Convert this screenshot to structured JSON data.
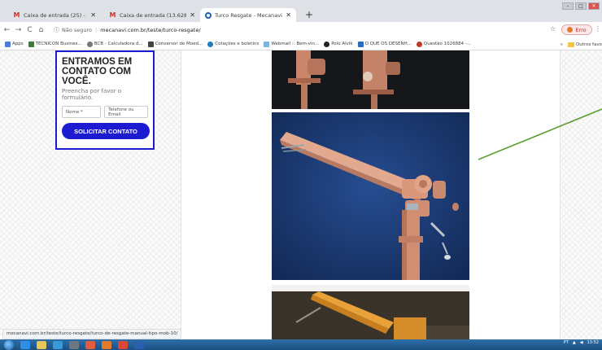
{
  "tabs": [
    {
      "title": "Caixa de entrada (25) - amasson...",
      "icon": "gmail-icon",
      "active": false
    },
    {
      "title": "Caixa de entrada (13.628) - amc...",
      "icon": "gmail-icon",
      "active": false
    },
    {
      "title": "Turco Resgate - Mecanavi",
      "icon": "site-icon",
      "active": true
    }
  ],
  "address": {
    "security": "Não seguro",
    "url": "mecanavi.com.br/teste/turco-resgate/"
  },
  "profile": {
    "label": "Erro"
  },
  "bookmarks": [
    {
      "label": "Apps",
      "color": "#4a7fd4"
    },
    {
      "label": "TECNICON Busines...",
      "color": "#3a7d3a"
    },
    {
      "label": "BCB - Calculadora d...",
      "color": "#777777"
    },
    {
      "label": "Conversor de Moed...",
      "color": "#444444"
    },
    {
      "label": "Cotações e boletins",
      "color": "#1e7fc0"
    },
    {
      "label": "Webmail :: Bem-vin...",
      "color": "#7ab4e0"
    },
    {
      "label": "Polo Alvik",
      "color": "#222222"
    },
    {
      "label": "O QUE OS DESENH...",
      "color": "#2b6bc4"
    },
    {
      "label": "Questão 1026884 -...",
      "color": "#c0392b"
    }
  ],
  "bookmarks_overflow": "»",
  "other_bookmarks": "Outros favo",
  "contact": {
    "title": "ENTRAMOS EM CONTATO COM VOCÊ.",
    "subtitle": "Preencha por favor o formulário.",
    "name_placeholder": "Nome *",
    "phone_placeholder": "Telefone ou Email",
    "button": "SOLICITAR CONTATO"
  },
  "status_url": "mecanavi.com.br/teste/turco-resgate/turco-de-resgate-manual-tipo-mob-10/",
  "tray": {
    "lang": "PT",
    "time": "13:52"
  },
  "colors": {
    "accent": "#1d1bd1",
    "pointer_line": "#5a9e2f"
  }
}
